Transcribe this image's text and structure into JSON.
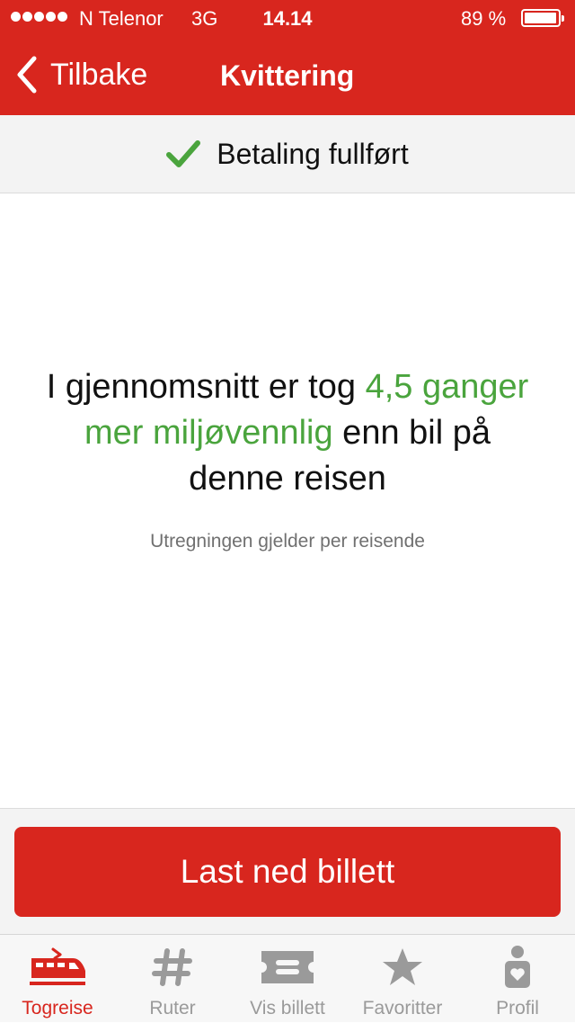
{
  "status_bar": {
    "carrier": "N Telenor",
    "network": "3G",
    "time": "14.14",
    "battery_percent": "89 %",
    "battery_level": 0.89
  },
  "nav": {
    "back_label": "Tilbake",
    "title": "Kvittering"
  },
  "banner": {
    "icon": "checkmark-icon",
    "text": "Betaling fullført"
  },
  "message": {
    "part1": "I gjennomsnitt er tog ",
    "highlight": "4,5 ganger mer miljøvennlig",
    "part2": " enn bil på denne reisen",
    "note": "Utregningen gjelder per reisende"
  },
  "actions": {
    "download_label": "Last ned billett"
  },
  "tabs": [
    {
      "label": "Togreise",
      "icon": "train-icon",
      "active": true
    },
    {
      "label": "Ruter",
      "icon": "hash-icon",
      "active": false
    },
    {
      "label": "Vis billett",
      "icon": "ticket-icon",
      "active": false
    },
    {
      "label": "Favoritter",
      "icon": "star-icon",
      "active": false
    },
    {
      "label": "Profil",
      "icon": "profile-icon",
      "active": false
    }
  ],
  "colors": {
    "brand_red": "#d8261e",
    "accent_green": "#4aa43d",
    "tab_inactive": "#9a9a9a"
  }
}
